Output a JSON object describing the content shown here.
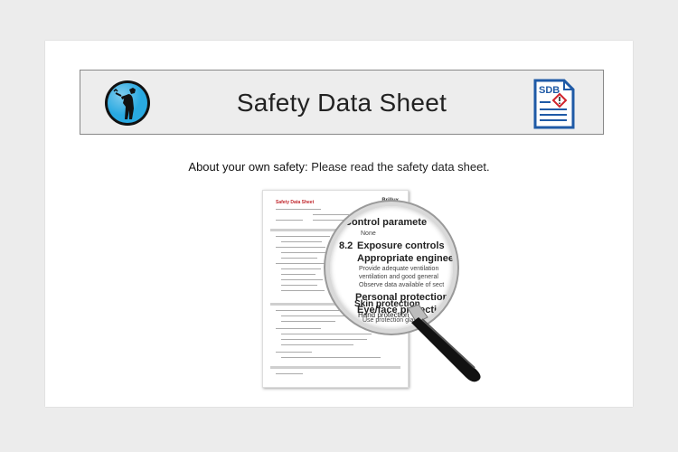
{
  "header": {
    "title": "Safety Data Sheet",
    "sdb_label": "SDB"
  },
  "intro": {
    "bold": "About your own safety:",
    "text": "Please read the safety data sheet."
  },
  "document": {
    "title": "Safety Data Sheet",
    "brand": "Brillux",
    "magnified": {
      "line1": "Control paramete",
      "line2": "None",
      "section_no": "8.2",
      "line3": "Exposure controls",
      "line4": "Appropriate engineer",
      "line5": "Provide adequate ventilation",
      "line6": "ventilation and good general",
      "line7": "Observe data available of sect",
      "line8": "Personal protection e",
      "line9": "Eye/face protection",
      "line10": "Use protection glasses in",
      "line11": "Skin protection",
      "line12": "Hand protection"
    }
  },
  "colors": {
    "background": "#ececec",
    "card": "#ffffff",
    "header_bg": "#ededed",
    "logo_blue": "#29a9e1",
    "sdb_blue": "#1f5aa6",
    "warning_red": "#d0232b"
  }
}
